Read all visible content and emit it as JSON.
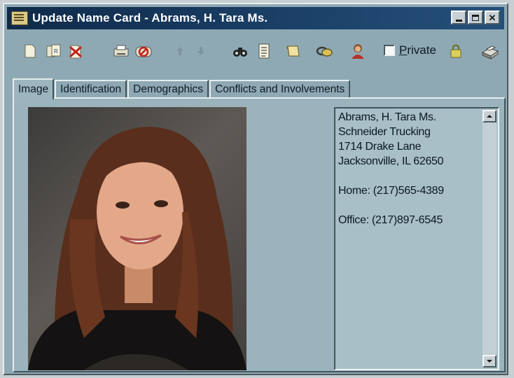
{
  "window": {
    "title": "Update Name Card - Abrams, H. Tara Ms."
  },
  "toolbar": {
    "icons": [
      "new-card-icon",
      "copy-card-icon",
      "delete-card-icon",
      "print-icon",
      "stop-icon",
      "up-arrow-icon",
      "down-arrow-icon",
      "binoculars-icon",
      "notes-icon",
      "scroll-icon",
      "link-icon",
      "person-icon",
      "lock-icon",
      "printer-icon"
    ],
    "private_label": "Private",
    "private_checked": false
  },
  "tabs": [
    {
      "label": "Image",
      "active": true
    },
    {
      "label": "Identification",
      "active": false
    },
    {
      "label": "Demographics",
      "active": false
    },
    {
      "label": "Conflicts and Involvements",
      "active": false
    }
  ],
  "card": {
    "name": "Abrams, H. Tara Ms.",
    "company": "Schneider Trucking",
    "street": "1714 Drake Lane",
    "city_state_zip": "Jacksonville, IL 62650",
    "home_phone": "Home: (217)565-4389",
    "office_phone": "Office: (217)897-6545"
  },
  "colors": {
    "title_bar": "#1b3f66",
    "window_bg": "#8fa9b4",
    "panel_bg": "#9bb3bd"
  }
}
